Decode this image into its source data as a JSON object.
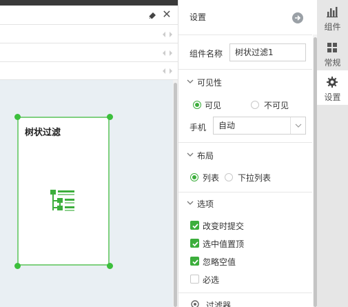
{
  "panel": {
    "title": "设置",
    "component_name_label": "组件名称",
    "component_name_value": "树状过滤1",
    "visibility": {
      "title": "可见性",
      "option_visible": "可见",
      "option_invisible": "不可见",
      "selected": "可见",
      "mobile_label": "手机",
      "mobile_value": "自动"
    },
    "layout": {
      "title": "布局",
      "option_list": "列表",
      "option_dropdown": "下拉列表",
      "selected": "列表"
    },
    "options": {
      "title": "选项",
      "items": [
        {
          "label": "改变时提交",
          "checked": true
        },
        {
          "label": "选中值置顶",
          "checked": true
        },
        {
          "label": "忽略空值",
          "checked": true
        },
        {
          "label": "必选",
          "checked": false
        }
      ]
    },
    "filter_label": "过滤器"
  },
  "widget": {
    "title": "树状过滤",
    "icon": "tree-filter-icon"
  },
  "rail": {
    "items": [
      {
        "label": "组件",
        "icon": "bar-chart-icon"
      },
      {
        "label": "常规",
        "icon": "grid-icon"
      },
      {
        "label": "设置",
        "icon": "gear-icon",
        "active": true
      }
    ]
  },
  "colors": {
    "accent": "#3cae3c",
    "selection_border": "#7fd07f",
    "canvas_bg": "#e9eff3"
  }
}
